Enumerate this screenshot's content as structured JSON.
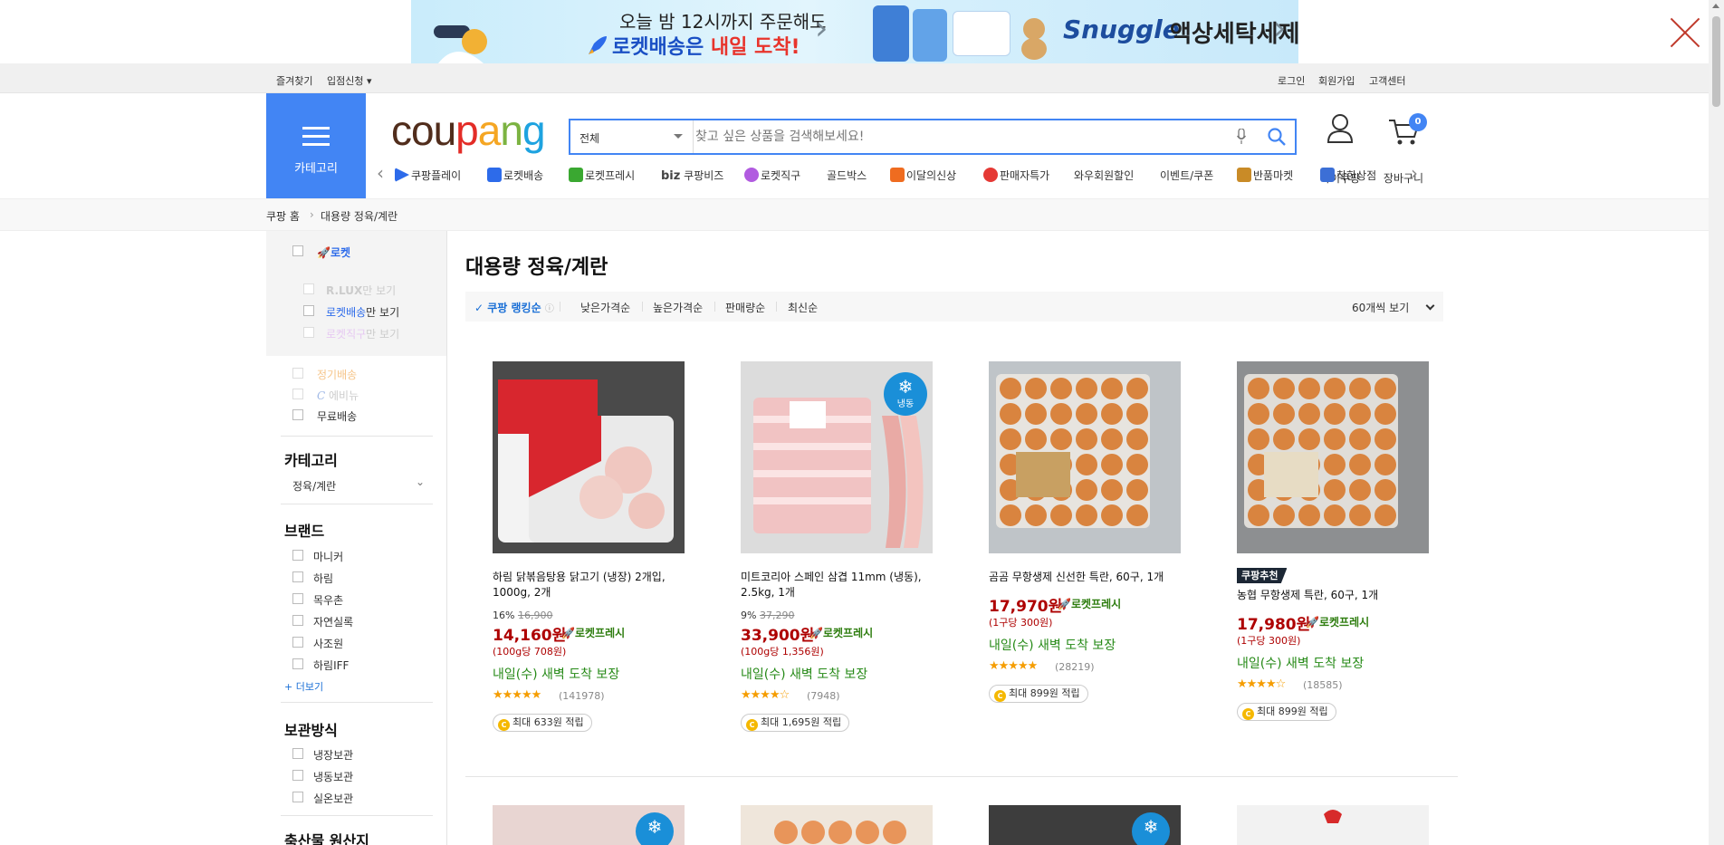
{
  "ad": {
    "line1": "오늘 밤 12시까지 주문해도",
    "line2_a": "로켓배송은 ",
    "line2_b": "내일 도착!",
    "brand": "Snuggle",
    "right_text": "액상세탁세제"
  },
  "util": {
    "bookmark": "즐겨찾기",
    "seller": "입점신청",
    "login": "로그인",
    "signup": "회원가입",
    "support": "고객센터"
  },
  "header": {
    "category_label": "카테고리",
    "logo": [
      "cou",
      "p",
      "a",
      "n",
      "g"
    ],
    "search_category": "전체",
    "search_placeholder": "찾고 싶은 상품을 검색해보세요!",
    "mycoupang": "마이쿠팡",
    "cart": "장바구니",
    "cart_count": "0"
  },
  "nav": [
    {
      "label": "쿠팡플레이",
      "color": "#2d6bea"
    },
    {
      "label": "로켓배송",
      "color": "#2d6bea"
    },
    {
      "label": "로켓프레시",
      "color": "#3aa831"
    },
    {
      "label": "쿠팡비즈",
      "color": "#444444"
    },
    {
      "label": "로켓직구",
      "color": "#b15be0"
    },
    {
      "label": "골드박스",
      "color": ""
    },
    {
      "label": "이달의신상",
      "color": "#ef6c20"
    },
    {
      "label": "판매자특가",
      "color": "#e53935"
    },
    {
      "label": "와우회원할인",
      "color": ""
    },
    {
      "label": "이벤트/쿠폰",
      "color": ""
    },
    {
      "label": "반품마켓",
      "color": "#c98b27"
    },
    {
      "label": "착한상점",
      "color": "#3c6fd6"
    }
  ],
  "nav_biz_prefix": "biz",
  "breadcrumb": {
    "home": "쿠팡 홈",
    "current": "대용량 정육/계란"
  },
  "sidebar": {
    "rocket": "로켓",
    "rlux_a": "R.LUX",
    "rlux_b": "만 보기",
    "rocket_delivery_a": "로켓배송",
    "rocket_delivery_b": "만 보기",
    "rocket_direct_a": "로켓직구",
    "rocket_direct_b": "만 보기",
    "subscription": "정기배송",
    "emart": "에비뉴",
    "free_shipping": "무료배송",
    "category_head": "카테고리",
    "category_value": "정육/계란",
    "brand_head": "브랜드",
    "brands": [
      "마니커",
      "하림",
      "목우촌",
      "자연실록",
      "사조원",
      "하림IFF"
    ],
    "more": "+ 더보기",
    "storage_head": "보관방식",
    "storage": [
      "냉장보관",
      "냉동보관",
      "실온보관"
    ],
    "origin_head": "축산물 원산지"
  },
  "main": {
    "title": "대용량 정육/계란",
    "sort": [
      "쿠팡 랭킹순",
      "낮은가격순",
      "높은가격순",
      "판매량순",
      "최신순"
    ],
    "per_page": "60개씩 보기"
  },
  "products": [
    {
      "name": "하림 닭볶음탕용 닭고기 (냉장) 2개입, 1000g, 2개",
      "discount": "16%",
      "original_price": "16,900",
      "price": "14,160원",
      "rocket": "로켓프레시",
      "unit_price": "(100g당 708원)",
      "arrival": "내일(수) 새벽 도착 보장",
      "stars": "★★★★★",
      "rating": 5.0,
      "reviews": "(141978)",
      "points": "최대 633원 적립",
      "badge": "",
      "frozen": ""
    },
    {
      "name": "미트코리아 스페인 삼겹 11mm (냉동), 2.5kg, 1개",
      "discount": "9%",
      "original_price": "37,290",
      "price": "33,900원",
      "rocket": "로켓프레시",
      "unit_price": "(100g당 1,356원)",
      "arrival": "내일(수) 새벽 도착 보장",
      "stars": "★★★★☆",
      "rating": 4.5,
      "reviews": "(7948)",
      "points": "최대 1,695원 적립",
      "badge": "",
      "frozen": "냉동"
    },
    {
      "name": "곰곰 무항생제 신선한 특란, 60구, 1개",
      "discount": "",
      "original_price": "",
      "price": "17,970원",
      "rocket": "로켓프레시",
      "unit_price": "(1구당 300원)",
      "arrival": "내일(수) 새벽 도착 보장",
      "stars": "★★★★★",
      "rating": 5.0,
      "reviews": "(28219)",
      "points": "최대 899원 적립",
      "badge": "",
      "frozen": ""
    },
    {
      "name": "농협 무항생제 특란, 60구, 1개",
      "discount": "",
      "original_price": "",
      "price": "17,980원",
      "rocket": "로켓프레시",
      "unit_price": "(1구당 300원)",
      "arrival": "내일(수) 새벽 도착 보장",
      "stars": "★★★★☆",
      "rating": 4.5,
      "reviews": "(18585)",
      "points": "최대 899원 적립",
      "badge": "쿠팡추천",
      "frozen": ""
    }
  ],
  "colors": {
    "accent": "#4285f4",
    "price_red": "#ae0000",
    "arrival_green": "#268a17"
  }
}
